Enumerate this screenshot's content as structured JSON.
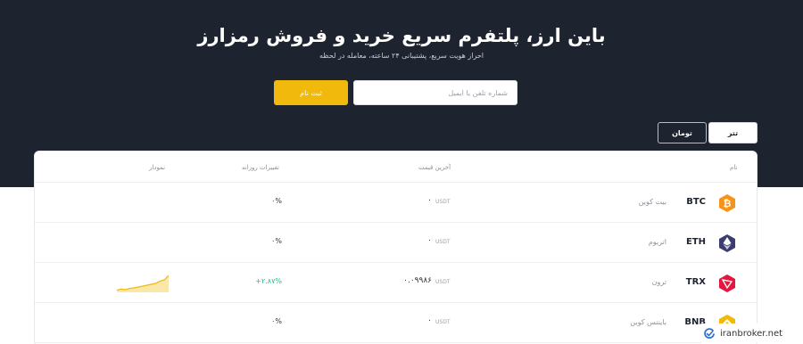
{
  "hero": {
    "title": "باین ارز، پلتفرم سریع خرید و فروش رمزارز",
    "subtitle": "احراز هویت سریع، پشتیبانی ۲۴ ساعته، معامله در لحظه",
    "input_placeholder": "شماره تلفن یا ایمیل",
    "signup_label": "ثبت نام"
  },
  "tabs": {
    "tether": "تتر",
    "toman": "تومان",
    "active": "toman"
  },
  "table": {
    "headers": {
      "name": "نام",
      "last_price": "آخرین قیمت",
      "daily_change": "تغییرات روزانه",
      "chart": "نمودار"
    },
    "rows": [
      {
        "symbol": "BTC",
        "name": "بیت کوین",
        "unit": "USDT",
        "price": "۰",
        "change": "۰%",
        "change_dir": "flat",
        "icon": "btc-icon",
        "color": "#f7931a",
        "sparkline": []
      },
      {
        "symbol": "ETH",
        "name": "اتریوم",
        "unit": "USDT",
        "price": "۰",
        "change": "۰%",
        "change_dir": "flat",
        "icon": "eth-icon",
        "color": "#3c3c6e",
        "sparkline": []
      },
      {
        "symbol": "TRX",
        "name": "ترون",
        "unit": "USDT",
        "price": "۰.۰۹۹۸۶",
        "change": "+۲.۸۷%",
        "change_dir": "up",
        "icon": "trx-icon",
        "color": "#e4173f",
        "sparkline": [
          0.12,
          0.18,
          0.15,
          0.22,
          0.25,
          0.3,
          0.35,
          0.4,
          0.45,
          0.5,
          0.62,
          0.7,
          0.95
        ]
      },
      {
        "symbol": "BNB",
        "name": "بایننس کوین",
        "unit": "USDT",
        "price": "۰",
        "change": "۰%",
        "change_dir": "flat",
        "icon": "bnb-icon",
        "color": "#f0b90b",
        "sparkline": []
      }
    ]
  },
  "watermark": {
    "text": "iranbroker.net",
    "icon": "iranbroker-logo-icon"
  },
  "colors": {
    "hero_bg": "#1e2330",
    "accent": "#f0b90b",
    "positive": "#16c784"
  }
}
